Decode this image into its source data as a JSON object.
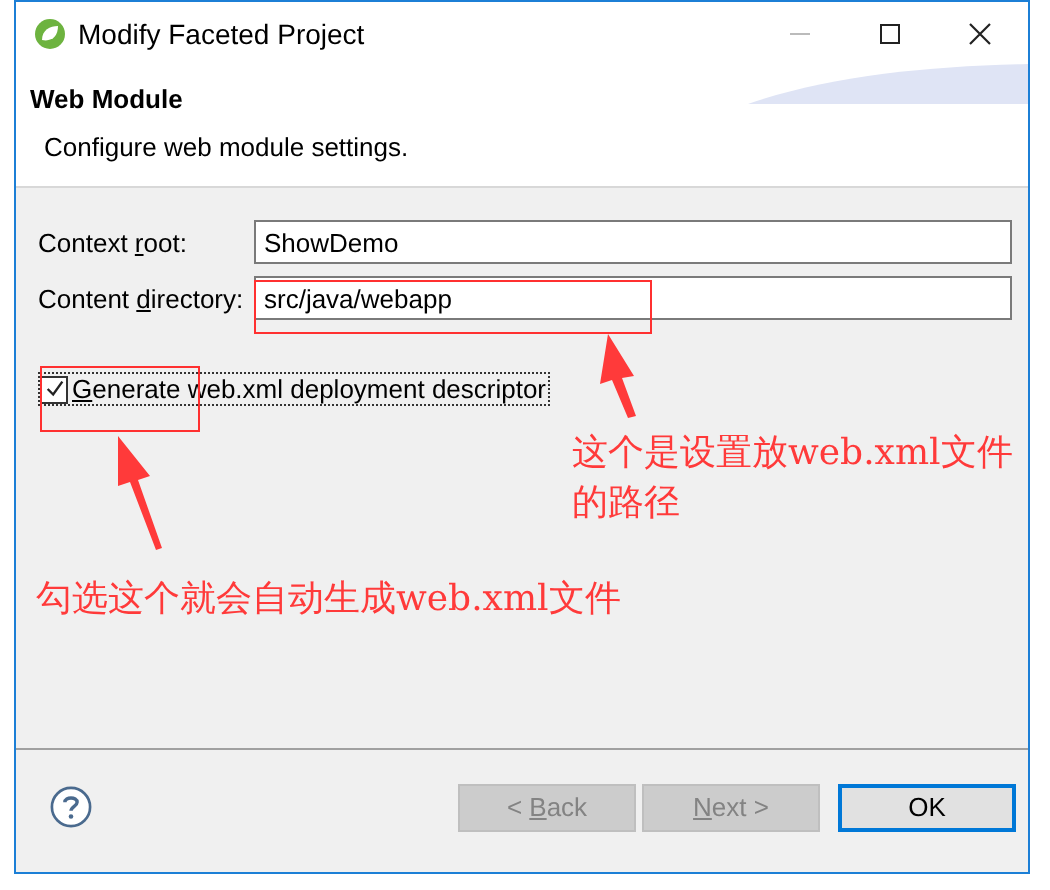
{
  "window": {
    "title": "Modify Faceted Project"
  },
  "header": {
    "title": "Web Module",
    "description": "Configure web module settings."
  },
  "fields": [
    {
      "label": {
        "before": "Context ",
        "key": "r",
        "after": "oot:"
      },
      "value": "ShowDemo"
    },
    {
      "label": {
        "before": "Content ",
        "key": "d",
        "after": "irectory:"
      },
      "value": "src/java/webapp"
    }
  ],
  "checkbox": {
    "label": {
      "key": "G",
      "after": "enerate web.xml deployment descriptor"
    },
    "checked": true
  },
  "buttons": [
    {
      "label": {
        "before": "< ",
        "key": "B",
        "after": "ack"
      },
      "disabled": true,
      "default": false
    },
    {
      "label": {
        "key": "N",
        "after": "ext >"
      },
      "disabled": true,
      "default": false
    },
    {
      "label": {
        "after": "OK"
      },
      "disabled": false,
      "default": true
    }
  ],
  "annotations": [
    {
      "kind": "box"
    },
    {
      "kind": "box"
    },
    {
      "kind": "arrow"
    },
    {
      "kind": "arrow"
    },
    {
      "kind": "note",
      "text": "这个是设置放web.xml文件的路径"
    },
    {
      "kind": "note",
      "text": "勾选这个就会自动生成web.xml文件"
    }
  ]
}
